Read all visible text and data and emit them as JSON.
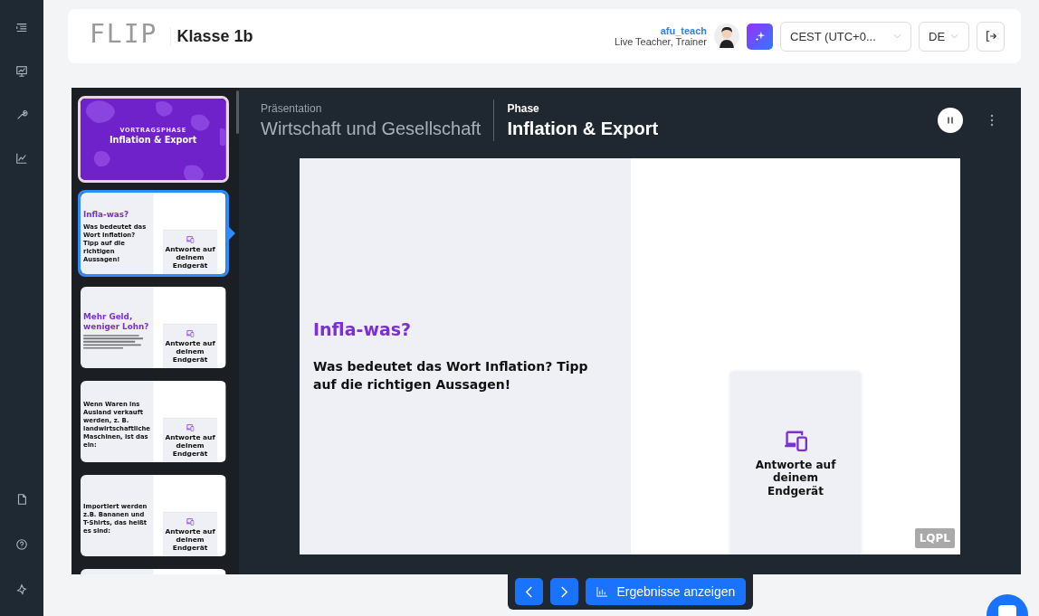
{
  "header": {
    "logo": "FLIP",
    "class_name": "Klasse 1b",
    "user": {
      "name": "afu_teach",
      "role": "Live Teacher, Trainer"
    },
    "timezone": "CEST (UTC+0...",
    "language": "DE"
  },
  "presentation": {
    "label": "Präsentation",
    "title": "Wirtschaft und Gesellschaft"
  },
  "phase": {
    "label": "Phase",
    "title": "Inflation & Export"
  },
  "slides": [
    {
      "kind": "title",
      "overline": "VORTRAGSPHASE",
      "title": "Inflation & Export",
      "selected": false
    },
    {
      "kind": "question",
      "title": "Infla-was?",
      "question": "Was bedeutet das Wort Inflation? Tipp auf die richtigen Aussagen!",
      "answer_hint": "Antworte auf deinem Endgerät",
      "selected": true
    },
    {
      "kind": "info",
      "title": "Mehr Geld, weniger Lohn?",
      "answer_hint": "Antworte auf deinem Endgerät",
      "selected": false
    },
    {
      "kind": "question",
      "question": "Wenn Waren ins Ausland verkauft werden, z. B. landwirtschaftliche Maschinen, ist das ein:",
      "answer_hint": "Antworte auf deinem Endgerät",
      "selected": false
    },
    {
      "kind": "question",
      "question": "Importiert werden z.B. Bananen und T-Shirts, das heißt es sind:",
      "answer_hint": "Antworte auf deinem Endgerät",
      "selected": false
    },
    {
      "kind": "question",
      "selected": false
    }
  ],
  "current_slide": {
    "title": "Infla-was?",
    "question": "Was bedeutet das Wort Inflation? Tipp auf die richtigen Aussagen!",
    "answer_hint": "Antworte auf deinem Endgerät",
    "badge": "LQPL"
  },
  "toolbar": {
    "results": "Ergebnisse anzeigen"
  }
}
